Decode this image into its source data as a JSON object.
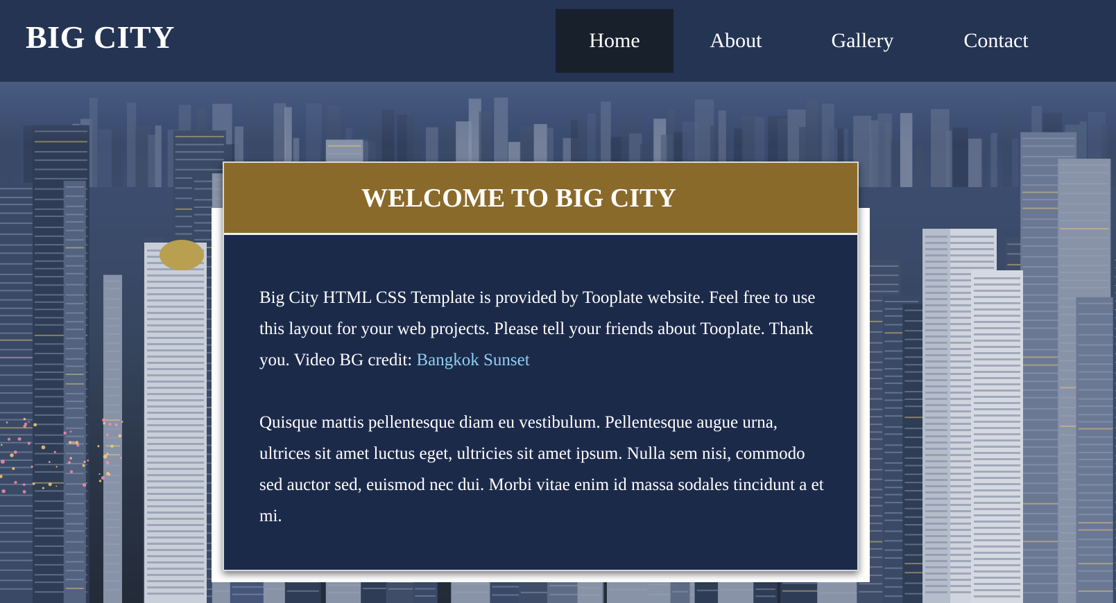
{
  "header": {
    "brand": "BIG CITY",
    "nav": [
      {
        "label": "Home",
        "active": true
      },
      {
        "label": "About",
        "active": false
      },
      {
        "label": "Gallery",
        "active": false
      },
      {
        "label": "Contact",
        "active": false
      }
    ]
  },
  "main": {
    "title": "WELCOME TO BIG CITY",
    "paragraph1_text": "Big City HTML CSS Template is provided by Tooplate website. Feel free to use this layout for your web projects. Please tell your friends about Tooplate. Thank you. Video BG credit: ",
    "credit_link": "Bangkok Sunset",
    "paragraph2": "Quisque mattis pellentesque diam eu vestibulum. Pellentesque augue urna, ultrices sit amet luctus eget, ultricies sit amet ipsum. Nulla sem nisi, commodo sed auctor sed, euismod nec dui. Morbi vitae enim id massa sodales tincidunt a et mi."
  },
  "colors": {
    "header_bg": "#243452",
    "nav_active_bg": "#18202c",
    "title_bar": "#8a6a2a",
    "panel_bg": "#1c2a4a",
    "link": "#8ed0f0"
  }
}
